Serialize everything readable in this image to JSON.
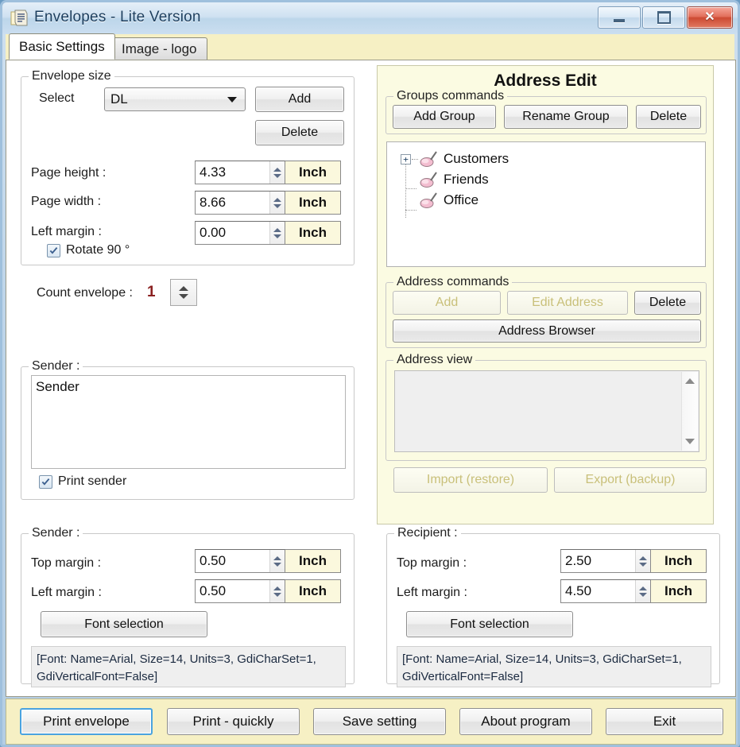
{
  "window": {
    "title": "Envelopes - Lite Version",
    "icon": "envelope-document-icon",
    "controls": {
      "minimize": "–",
      "maximize": "□",
      "close": "✕"
    }
  },
  "tabs": [
    {
      "label": "Basic Settings",
      "active": true
    },
    {
      "label": "Image - logo",
      "active": false
    }
  ],
  "envelope_size": {
    "group_title": "Envelope size",
    "select_label": "Select",
    "select_value": "DL",
    "add_label": "Add",
    "delete_label": "Delete",
    "page_height_label": "Page height :",
    "page_height_value": "4.33",
    "page_width_label": "Page width :",
    "page_width_value": "8.66",
    "left_margin_label": "Left margin  :",
    "left_margin_value": "0.00",
    "unit": "Inch",
    "rotate_label": "Rotate 90 °",
    "rotate_checked": true
  },
  "count": {
    "label": "Count envelope :",
    "value": "1",
    "value_color": "#8a2020"
  },
  "sender_text": {
    "group_title": "Sender :",
    "text": "Sender",
    "print_sender_label": "Print sender",
    "print_sender_checked": true
  },
  "sender_margins": {
    "group_title": "Sender :",
    "top_label": "Top margin  :",
    "top_value": "0.50",
    "left_label": "Left margin :",
    "left_value": "0.50",
    "unit": "Inch",
    "font_button": "Font selection",
    "font_info": "[Font: Name=Arial, Size=14, Units=3, GdiCharSet=1, GdiVerticalFont=False]"
  },
  "recipient_margins": {
    "group_title": "Recipient :",
    "top_label": "Top margin  :",
    "top_value": "2.50",
    "left_label": "Left margin :",
    "left_value": "4.50",
    "unit": "Inch",
    "font_button": "Font selection",
    "font_info": "[Font: Name=Arial, Size=14, Units=3, GdiCharSet=1, GdiVerticalFont=False]"
  },
  "address_edit": {
    "title": "Address Edit",
    "groups_commands": {
      "group_title": "Groups commands",
      "add_group": "Add Group",
      "rename_group": "Rename Group",
      "delete": "Delete"
    },
    "tree": [
      {
        "label": "Customers",
        "expandable": true,
        "expander": "+"
      },
      {
        "label": "Friends",
        "expandable": false,
        "expander": ""
      },
      {
        "label": "Office",
        "expandable": false,
        "expander": ""
      }
    ],
    "address_commands": {
      "group_title": "Address commands",
      "add": "Add",
      "add_enabled": false,
      "edit_address": "Edit Address",
      "edit_enabled": false,
      "delete": "Delete",
      "delete_enabled": true,
      "address_browser": "Address Browser"
    },
    "address_view": {
      "group_title": "Address view",
      "content": ""
    },
    "import_label": "Import (restore)",
    "export_label": "Export (backup)",
    "import_enabled": false,
    "export_enabled": false
  },
  "bottom_buttons": [
    {
      "label": "Print envelope",
      "focused": true
    },
    {
      "label": "Print - quickly",
      "focused": false
    },
    {
      "label": "Save setting",
      "focused": false
    },
    {
      "label": "About program",
      "focused": false
    },
    {
      "label": "Exit",
      "focused": false
    }
  ],
  "colors": {
    "panel_cream": "#fbfbe2",
    "tabstrip": "#f6f0c4",
    "inch_bg": "#fbf8dd",
    "count_value": "#8a2020",
    "focus_blue": "#4aa3df"
  }
}
